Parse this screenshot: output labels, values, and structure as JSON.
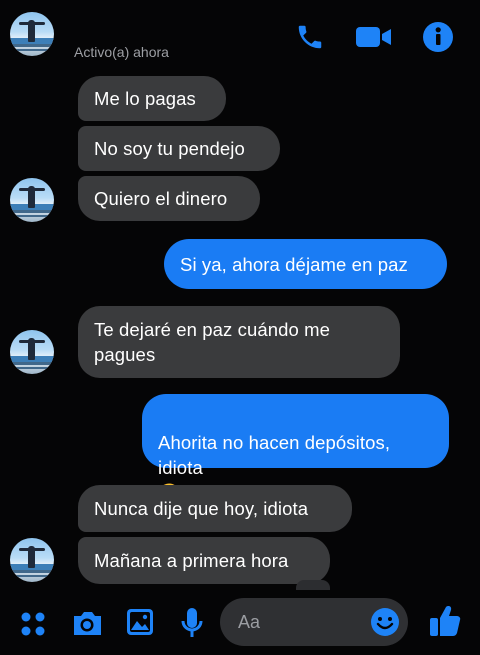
{
  "header": {
    "status": "Activo(a) ahora",
    "icons": [
      "avatar",
      "phone-icon",
      "video-camera-icon",
      "info-icon"
    ]
  },
  "messages": [
    {
      "side": "in",
      "text": "Me lo pagas"
    },
    {
      "side": "in",
      "text": "No soy tu pendejo"
    },
    {
      "side": "in",
      "text": "Quiero el dinero"
    },
    {
      "side": "out",
      "text": "Si ya, ahora déjame en paz"
    },
    {
      "side": "in",
      "text": "Te dejaré en paz cuándo me\npagues"
    },
    {
      "side": "out",
      "text": "Ahorita no hacen depósitos,\nidiota",
      "emoji": "😳"
    },
    {
      "side": "in",
      "text": "Nunca dije que hoy, idiota"
    },
    {
      "side": "in",
      "text": "Mañana a primera hora"
    }
  ],
  "composer": {
    "placeholder": "Aa",
    "icons": [
      "menu-dots-icon",
      "camera-icon",
      "gallery-icon",
      "microphone-icon",
      "emoji-icon",
      "thumbs-up-icon"
    ]
  },
  "colors": {
    "background": "#050506",
    "incoming_bubble": "#3a3b3d",
    "outgoing_bubble": "#1a7cf4",
    "accent": "#1877f2"
  }
}
